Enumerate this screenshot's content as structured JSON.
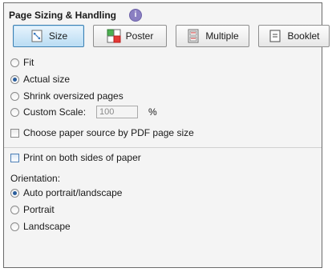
{
  "header": {
    "title": "Page Sizing & Handling",
    "info_glyph": "i"
  },
  "tabs": [
    {
      "label": "Size",
      "icon": "size-icon",
      "active": true
    },
    {
      "label": "Poster",
      "icon": "poster-icon",
      "active": false
    },
    {
      "label": "Multiple",
      "icon": "multiple-icon",
      "active": false
    },
    {
      "label": "Booklet",
      "icon": "booklet-icon",
      "active": false
    }
  ],
  "sizing_options": {
    "fit": "Fit",
    "actual_size": "Actual size",
    "shrink": "Shrink oversized pages",
    "custom_scale": "Custom Scale:",
    "selected": "Actual size"
  },
  "custom_scale": {
    "value": "100",
    "unit": "%"
  },
  "paper_source": {
    "label": "Choose paper source by PDF page size",
    "checked": false
  },
  "duplex": {
    "label": "Print on both sides of paper",
    "checked": false
  },
  "orientation": {
    "label": "Orientation:",
    "options": [
      "Auto portrait/landscape",
      "Portrait",
      "Landscape"
    ],
    "selected": "Auto portrait/landscape"
  },
  "colors": {
    "active_tab": "#b9dcf3",
    "active_border": "#3c7fb1",
    "radio_dot": "#2b5e9c"
  }
}
